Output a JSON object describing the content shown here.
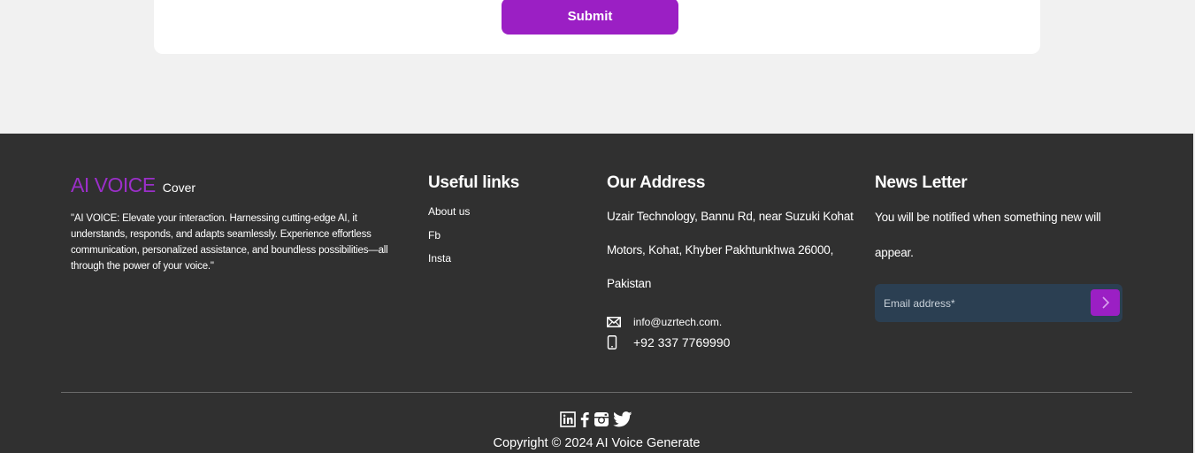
{
  "form": {
    "submit_label": "Submit"
  },
  "footer": {
    "brand": {
      "name": "AI VOICE",
      "sub": "Cover"
    },
    "about": "\"AI VOICE: Elevate your interaction. Harnessing cutting-edge AI, it understands, responds, and adapts seamlessly. Experience effortless communication, personalized assistance, and boundless possibilities—all through the power of your voice.\"",
    "useful_links": {
      "title": "Useful links",
      "items": [
        {
          "label": "About us"
        },
        {
          "label": "Fb"
        },
        {
          "label": "Insta"
        }
      ]
    },
    "address": {
      "title": "Our Address",
      "text": "Uzair Technology, Bannu Rd, near Suzuki Kohat Motors, Kohat, Khyber Pakhtunkhwa 26000, Pakistan",
      "email": "info@uzrtech.com.",
      "phone": "+92 337 7769990"
    },
    "newsletter": {
      "title": "News Letter",
      "text": "You will be notified when something new will appear.",
      "placeholder": "Email address*"
    },
    "social_icons": [
      "linkedin-icon",
      "facebook-icon",
      "instagram-icon",
      "twitter-icon"
    ],
    "copyright": "Copyright © 2024 AI Voice Generate"
  },
  "colors": {
    "accent": "#9b1fc4",
    "footer_bg": "#303030",
    "page_bg": "#f1f1f1",
    "newsletter_bg": "#2b3f52"
  }
}
